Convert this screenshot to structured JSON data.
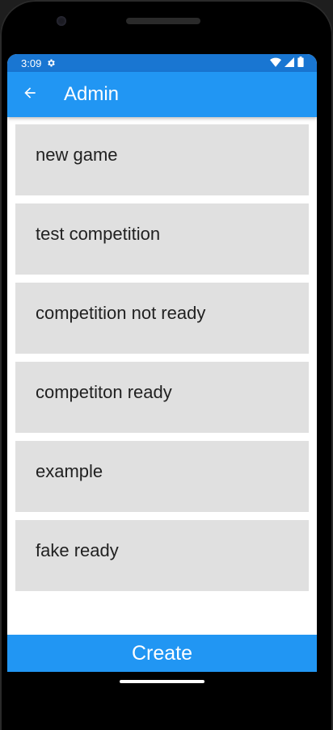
{
  "status_bar": {
    "time": "3:09",
    "icons": [
      "settings-icon",
      "wifi-icon",
      "signal-icon",
      "battery-icon"
    ]
  },
  "app_bar": {
    "back_icon": "arrow-back-icon",
    "title": "Admin"
  },
  "list": {
    "items": [
      {
        "label": "new game"
      },
      {
        "label": "test competition"
      },
      {
        "label": "competition not ready"
      },
      {
        "label": "competiton ready"
      },
      {
        "label": "example"
      },
      {
        "label": "fake ready"
      }
    ]
  },
  "footer": {
    "create_label": "Create"
  },
  "colors": {
    "status_bar": "#1976d2",
    "app_bar": "#2196f3",
    "list_item_bg": "#e0e0e0",
    "create_button": "#2196f3"
  }
}
